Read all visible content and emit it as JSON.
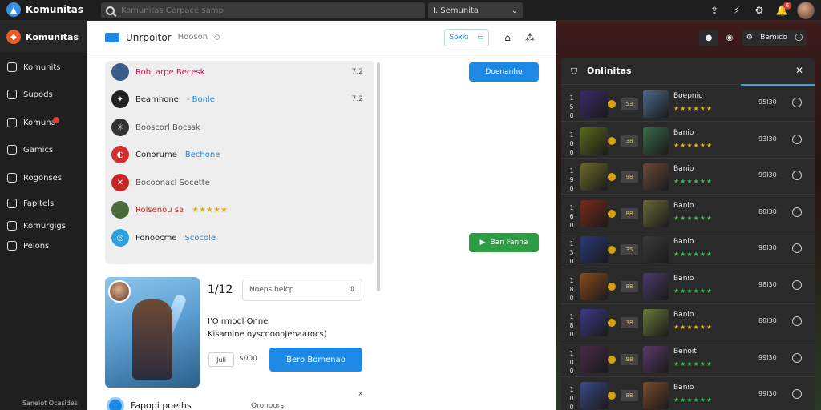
{
  "app": {
    "title": "Komunitas"
  },
  "topbar": {
    "search_placeholder": "Komunitas Cerpace samp",
    "select_label": "I. Semunita",
    "icons": [
      "upload-icon",
      "bolt-icon",
      "gear-icon",
      "bell-icon",
      "avatar"
    ],
    "notif_count": "6"
  },
  "sidebar": {
    "header": "Komunitas",
    "items": [
      {
        "label": "Komunits",
        "icon": "home-icon"
      },
      {
        "label": "Supods",
        "icon": "list-icon"
      },
      {
        "label": "Komuna",
        "icon": "chat-icon",
        "badge": true
      },
      {
        "label": "Gamics",
        "icon": "gamepad-icon"
      },
      {
        "label": "Rogonses",
        "icon": "box-icon"
      },
      {
        "label": "Fapitels",
        "icon": "file-icon"
      },
      {
        "label": "Komurgigs",
        "icon": "flag-icon"
      },
      {
        "label": "Pelons",
        "icon": "grid-icon"
      }
    ],
    "footer": "Saneiot Ocasides"
  },
  "main": {
    "header": {
      "title": "Unrpoitor",
      "subtitle": "Hooson",
      "pill_label": "Soxki"
    },
    "chats": [
      {
        "name": "Robi arpe Becesk",
        "tag": "",
        "time": "7.2",
        "color": "#3b5b8a",
        "name_color": "#c2185b"
      },
      {
        "name": "Beamhone",
        "tag": "- Bonle",
        "time": "7.2",
        "color": "#222222",
        "name_color": "#222222"
      },
      {
        "name": "Booscorl Bocssk",
        "tag": "",
        "time": "",
        "color": "#333333",
        "name_color": "#555555"
      },
      {
        "name": "Conorume",
        "tag": "Bechone",
        "time": "",
        "color": "#d32f2f",
        "name_color": "#222222"
      },
      {
        "name": "Bocoonacl Socette",
        "tag": "",
        "time": "",
        "color": "#c62828",
        "name_color": "#555555"
      },
      {
        "name": "Rolsenou sa",
        "tag": "★★★★★",
        "time": "",
        "color": "#4a6a3a",
        "name_color": "#c62828"
      },
      {
        "name": "Fonoocme",
        "tag": "Scocole",
        "time": "",
        "color": "#29a3e0",
        "name_color": "#222222"
      }
    ],
    "blue_button": "Doenanho",
    "green_button": "Ban Fanna",
    "level": "1/12",
    "select_label": "Noeps beicp",
    "info_line1": "I'O rmool Onne",
    "info_line2": "Kisamine oyscooonJehaarocs)",
    "price_tag": "Juli",
    "price": "$000",
    "buy_button": "Bero Bomenao",
    "close_label": "x",
    "bottom_name": "Fapopi poeihs",
    "bottom_stat": "Oronoors"
  },
  "right": {
    "btn3_label": "Bemico",
    "panel": {
      "title": "Onlinitas",
      "rows": [
        {
          "rank": "1 5 0",
          "chip": "53",
          "name": "Boepnio",
          "stars": "★★★★★★",
          "star_color": "#e0b020",
          "score": "95I30",
          "c1": "#3a2a6a",
          "c2": "#4a6a8a"
        },
        {
          "rank": "1 0 0",
          "chip": "38",
          "name": "Banio",
          "stars": "★★★★★★",
          "star_color": "#e0b020",
          "score": "93I30",
          "c1": "#5a6a1a",
          "c2": "#3a6a4a"
        },
        {
          "rank": "1 9 0",
          "chip": "98",
          "name": "Banio",
          "stars": "★★★★★★",
          "star_color": "#3ec050",
          "score": "99I30",
          "c1": "#6a6a2a",
          "c2": "#6a4a3a"
        },
        {
          "rank": "1 6 0",
          "chip": "88",
          "name": "Banio",
          "stars": "★★★★★★",
          "star_color": "#3ec050",
          "score": "88I30",
          "c1": "#7a2a1a",
          "c2": "#6a6a3a"
        },
        {
          "rank": "1 3 0",
          "chip": "35",
          "name": "Banio",
          "stars": "★★★★★★",
          "star_color": "#3ec050",
          "score": "98I30",
          "c1": "#2a3a7a",
          "c2": "#3a3a3a"
        },
        {
          "rank": "1 8 0",
          "chip": "88",
          "name": "Banio",
          "stars": "★★★★★★",
          "star_color": "#3ec050",
          "score": "98I30",
          "c1": "#8a4a1a",
          "c2": "#4a3a6a"
        },
        {
          "rank": "1 8 0",
          "chip": "38",
          "name": "Banio",
          "stars": "★★★★★★",
          "star_color": "#e0b020",
          "score": "88I30",
          "c1": "#3a3a8a",
          "c2": "#6a7a3a"
        },
        {
          "rank": "1 0 0",
          "chip": "98",
          "name": "Benoit",
          "stars": "★★★★★★",
          "star_color": "#3ec050",
          "score": "99I30",
          "c1": "#4a2a4a",
          "c2": "#5a3a6a"
        },
        {
          "rank": "1 0 0",
          "chip": "88",
          "name": "Banio",
          "stars": "★★★★★★",
          "star_color": "#3ec050",
          "score": "99I30",
          "c1": "#3a4a8a",
          "c2": "#7a4a2a"
        }
      ]
    }
  }
}
